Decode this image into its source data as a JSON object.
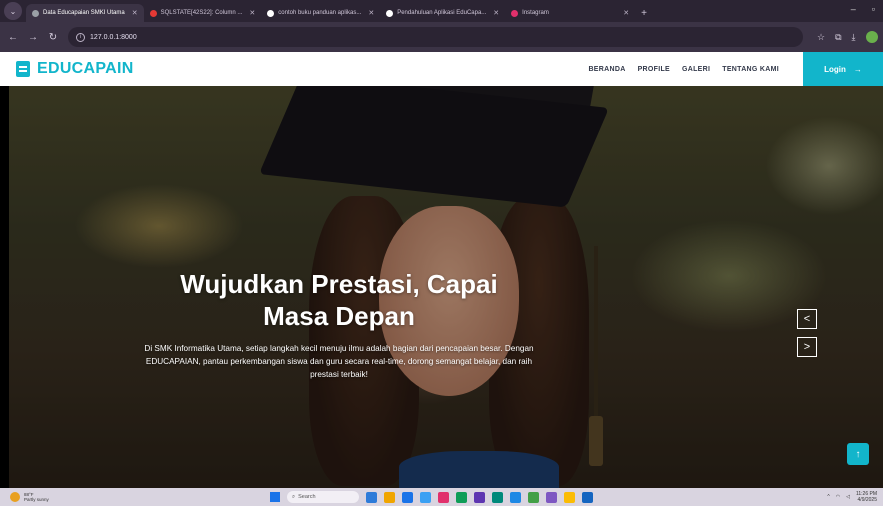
{
  "browser": {
    "tabs": [
      {
        "label": "Data Educapaian SMKI Utama",
        "active": true,
        "favicon_color": "#9aa0a6"
      },
      {
        "label": "SQLSTATE[42S22]: Column ...",
        "active": false,
        "favicon_color": "#e53935"
      },
      {
        "label": "contoh buku panduan aplikas...",
        "active": false,
        "favicon_color": "#ffffff"
      },
      {
        "label": "Pendahuluan Aplikasi EduCapa...",
        "active": false,
        "favicon_color": "#ffffff"
      },
      {
        "label": "Instagram",
        "active": false,
        "favicon_color": "#e1306c"
      }
    ],
    "url": "127.0.0.1:8000",
    "new_tab_symbol": "+",
    "window_controls": [
      "–",
      "▫"
    ]
  },
  "navbar": {
    "brand": "EDUCAPAIN",
    "menu": [
      "BERANDA",
      "PROFILE",
      "GALERI",
      "TENTANG KAMI"
    ],
    "login_label": "Login",
    "login_arrow": "→",
    "accent_color": "#12b5cb"
  },
  "hero": {
    "title_line1": "Wujudkan Prestasi, Capai",
    "title_line2": "Masa Depan",
    "description": "Di SMK Informatika Utama, setiap langkah kecil menuju ilmu adalah bagian dari pencapaian besar. Dengan EDUCAPAIAN, pantau perkembangan siswa dan guru secara real-time, dorong semangat belajar, dan raih prestasi terbaik!",
    "prev_symbol": "<",
    "next_symbol": ">",
    "to_top_symbol": "↑"
  },
  "taskbar": {
    "weather_temp": "88°F",
    "weather_desc": "Partly sunny",
    "search_placeholder": "Search",
    "time": "11:26 PM",
    "date": "4/9/2025",
    "app_colors": [
      "#2d7bd9",
      "#f0a500",
      "#1a73e8",
      "#3aa0f3",
      "#e1306c",
      "#0f9d58",
      "#5e35b1",
      "#00897b",
      "#1e88e5",
      "#43a047",
      "#7e57c2",
      "#fbbc04",
      "#1565c0"
    ]
  }
}
